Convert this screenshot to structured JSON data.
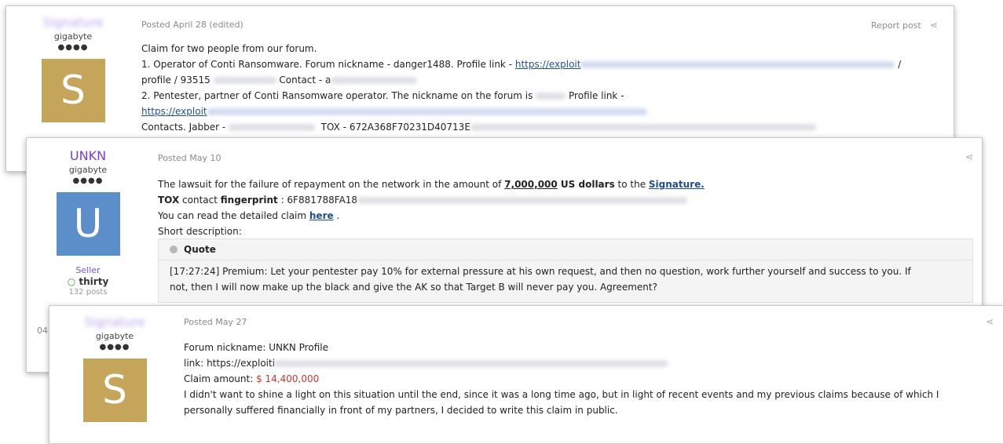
{
  "posts": [
    {
      "author": "Signature",
      "group": "gigabyte",
      "pips": "●●●●",
      "avatar_letter": "S",
      "avatar_color": "#c5a55a",
      "posted": "Posted April 28 (edited)",
      "report_label": "Report post",
      "lines": {
        "l1": "Claim for two people from our forum.",
        "l2_text": "1. Operator of Conti Ransomware. Forum nickname - danger1488. Profile link - ",
        "l2_link": "https://exploit",
        "l2_end": "/",
        "l3_text": "profile / 93515",
        "l3_contact": "Contact - a",
        "l4_text": "2. Pentester, partner of Conti Ransomware operator. The nickname on the forum is",
        "l4_profile": "Profile link -",
        "l5_link": "https://exploit",
        "l6_text": "Contacts. Jabber -",
        "l6_tox": "TOX - 672A368F70231D40713E"
      }
    },
    {
      "author": "UNKN",
      "author_color": "#7a3fd0",
      "group": "gigabyte",
      "pips": "●●●●",
      "avatar_letter": "U",
      "avatar_color": "#5c8ec9",
      "seller": "Seller",
      "online_label": "thirty",
      "posts_count": "132 posts",
      "side_date": "04",
      "posted": "Posted May 10",
      "lines": {
        "l1_pre": "The lawsuit for the failure of repayment on the network in the amount of ",
        "l1_amount": "7,000,000",
        "l1_usd": " US dollars",
        "l1_mid": " to the ",
        "l1_link": "Signature.",
        "l2_tox": "TOX",
        "l2_contact": " contact ",
        "l2_fp": "fingerprint",
        "l2_val": " : 6F881788FA18",
        "l3_pre": "You can read the detailed claim ",
        "l3_link": "here",
        "l3_end": " .",
        "l4": "Short description:"
      },
      "quote": {
        "title": "Quote",
        "q1": "[17:27:24] Premium: Let your pentester pay 10% for external pressure at his own request, and then no question, work further yourself and success to you. If",
        "q2": "not, then I will now make up the black and give the AK so that Target B will never pay you. Agreement?"
      }
    },
    {
      "author": "Signature",
      "group": "gigabyte",
      "pips": "●●●●",
      "avatar_letter": "S",
      "avatar_color": "#c5a55a",
      "posted": "Posted May 27",
      "lines": {
        "l1": "Forum nickname: UNKN Profile",
        "l2": "link: https://exploiti",
        "l3_label": "Claim amount: ",
        "l3_amount": "$ 14,400,000",
        "l4": "I didn't want to shine a light on this situation until the end, since it was a long time ago, but in light of recent events and my previous claims because of which I",
        "l5": "personally suffered financially in front of my partners, I decided to write this claim in public."
      }
    }
  ],
  "icons": {
    "share": "share-icon",
    "quote": "quote-icon",
    "online": "online-dot-icon"
  }
}
